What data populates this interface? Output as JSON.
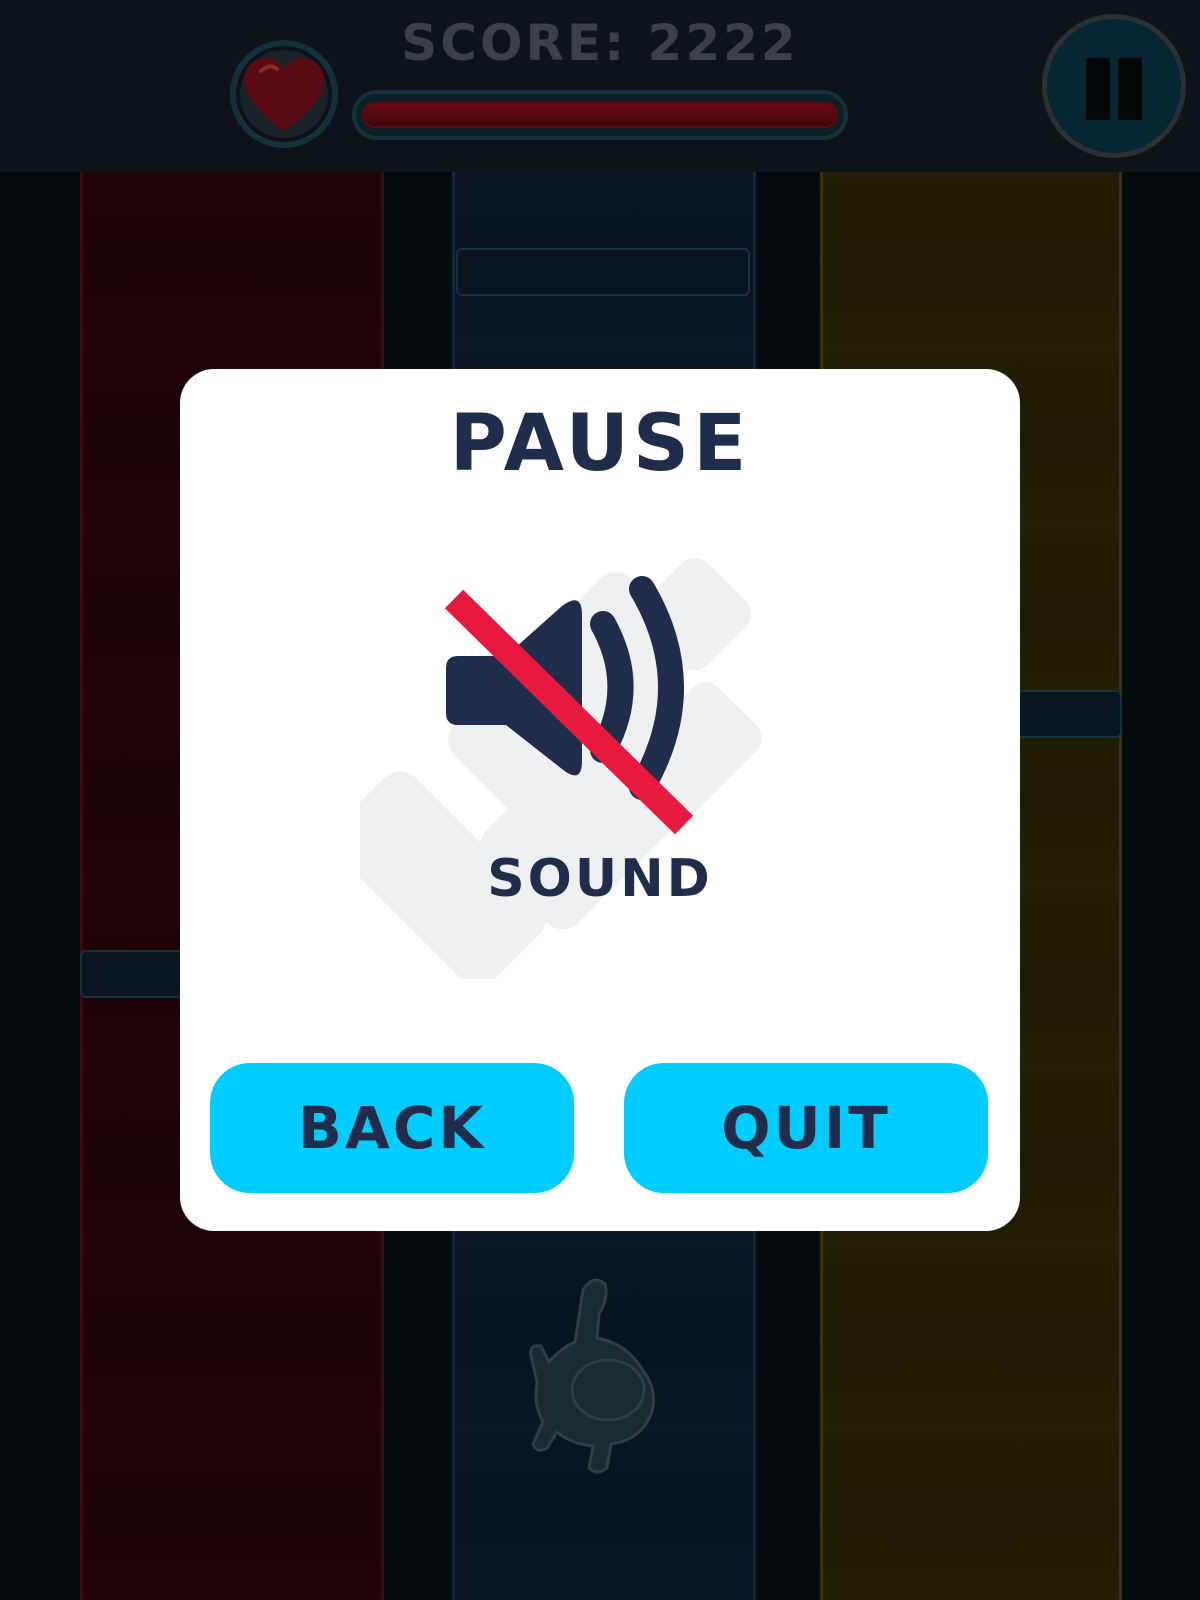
{
  "hud": {
    "score_text": "SCORE: 2222",
    "health_fraction": 1.0,
    "heart_icon": "heart-icon",
    "pause_icon": "pause-icon"
  },
  "dialog": {
    "title": "PAUSE",
    "sound": {
      "label": "SOUND",
      "muted": true,
      "icon": "speaker-muted-icon"
    },
    "buttons": {
      "back_label": "BACK",
      "quit_label": "QUIT"
    }
  },
  "colors": {
    "accent_button": "#00ccff",
    "dialog_text": "#1f2c4a",
    "mute_slash": "#e8193f",
    "lane_red": "#200508",
    "lane_blue": "#0b1521",
    "lane_yellow": "#221e05"
  }
}
